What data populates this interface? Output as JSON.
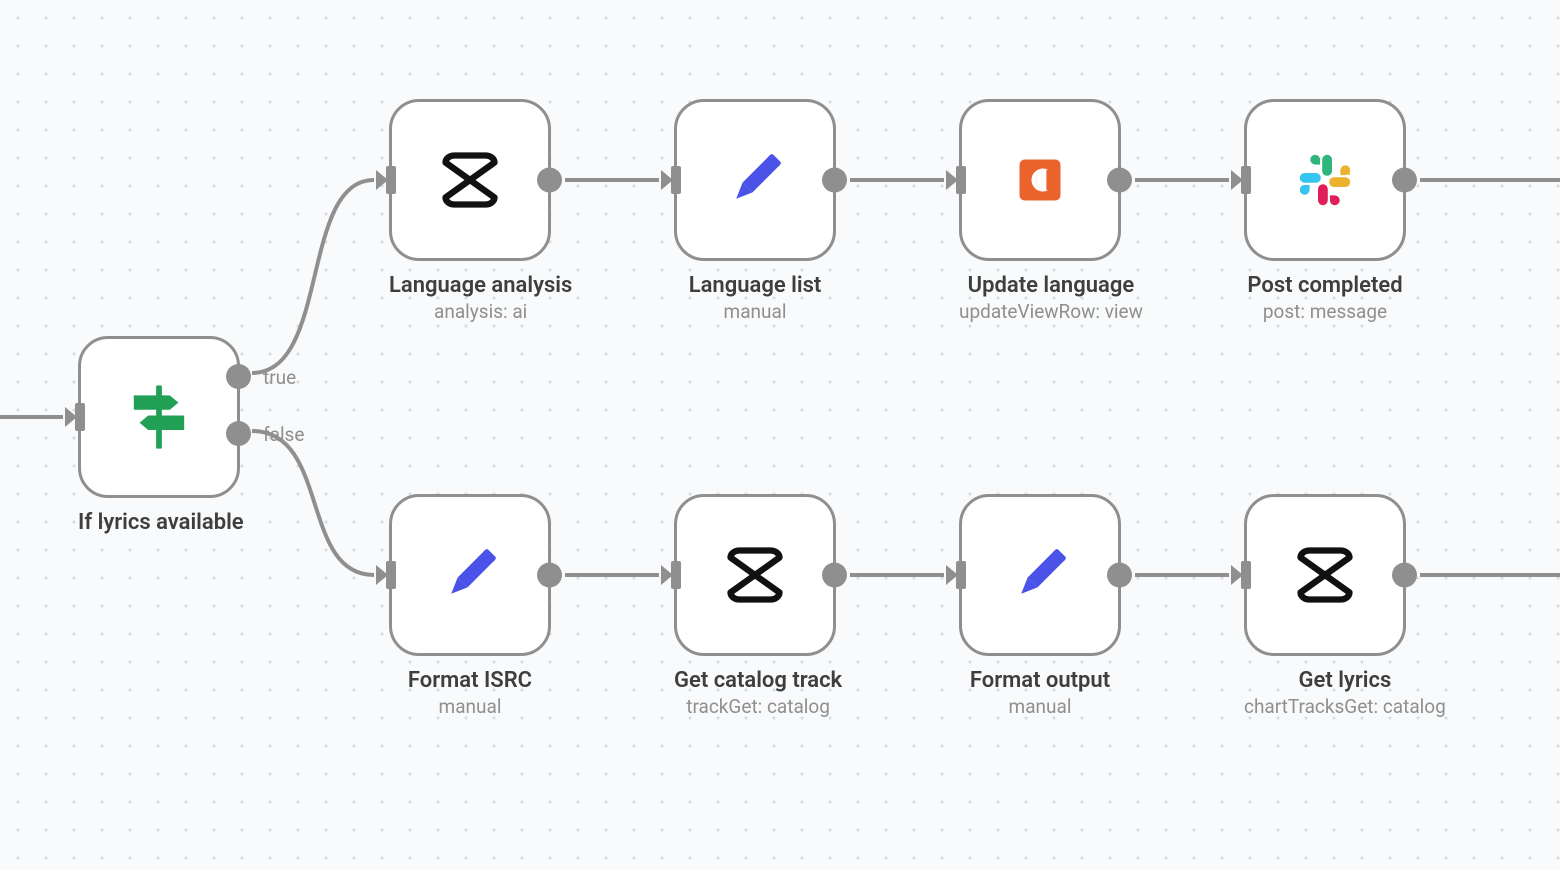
{
  "branch": {
    "title": "If lyrics available",
    "true_label": "true",
    "false_label": "false"
  },
  "top": [
    {
      "title": "Language analysis",
      "subtitle": "analysis: ai",
      "icon": "cross"
    },
    {
      "title": "Language list",
      "subtitle": "manual",
      "icon": "pencil"
    },
    {
      "title": "Update language",
      "subtitle": "updateViewRow: view",
      "icon": "coda"
    },
    {
      "title": "Post completed",
      "subtitle": "post: message",
      "icon": "slack"
    }
  ],
  "bottom": [
    {
      "title": "Format ISRC",
      "subtitle": "manual",
      "icon": "pencil"
    },
    {
      "title": "Get catalog track",
      "subtitle": "trackGet: catalog",
      "icon": "cross"
    },
    {
      "title": "Format output",
      "subtitle": "manual",
      "icon": "pencil"
    },
    {
      "title": "Get lyrics",
      "subtitle": "chartTracksGet: catalog",
      "icon": "cross"
    }
  ],
  "icons": {
    "cross": "cross-icon",
    "pencil": "pencil-icon",
    "coda": "coda-icon",
    "slack": "slack-icon",
    "branch": "signpost-icon"
  }
}
